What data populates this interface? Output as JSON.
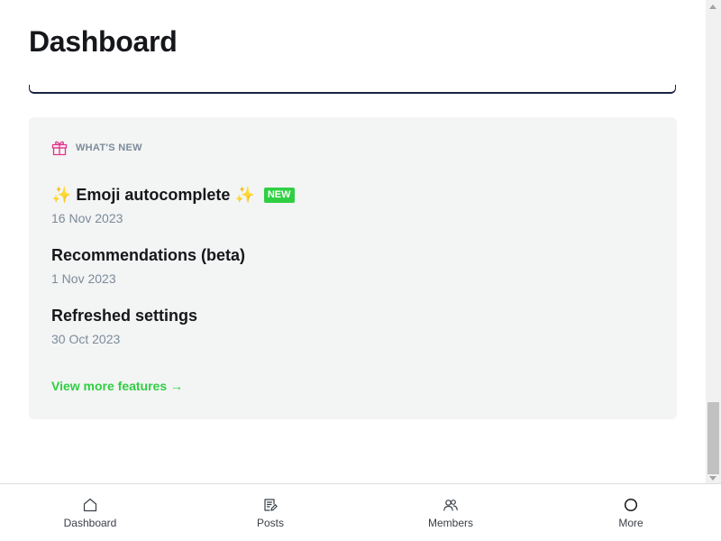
{
  "page": {
    "title": "Dashboard"
  },
  "whats_new": {
    "heading": "WHAT'S NEW",
    "items": [
      {
        "title": "✨ Emoji autocomplete ✨",
        "badge": "NEW",
        "date": "16 Nov 2023"
      },
      {
        "title": "Recommendations (beta)",
        "date": "1 Nov 2023"
      },
      {
        "title": "Refreshed settings",
        "date": "30 Oct 2023"
      }
    ],
    "view_more_label": "View more features →"
  },
  "bottom_nav": {
    "items": [
      {
        "label": "Dashboard",
        "icon": "home-icon"
      },
      {
        "label": "Posts",
        "icon": "posts-icon"
      },
      {
        "label": "Members",
        "icon": "members-icon"
      },
      {
        "label": "More",
        "icon": "circle-icon"
      }
    ]
  },
  "colors": {
    "accent_green": "#30cf43",
    "muted_text": "#7c8b9a",
    "card_bg": "#f3f4f4",
    "gift_pink": "#e0338a"
  }
}
